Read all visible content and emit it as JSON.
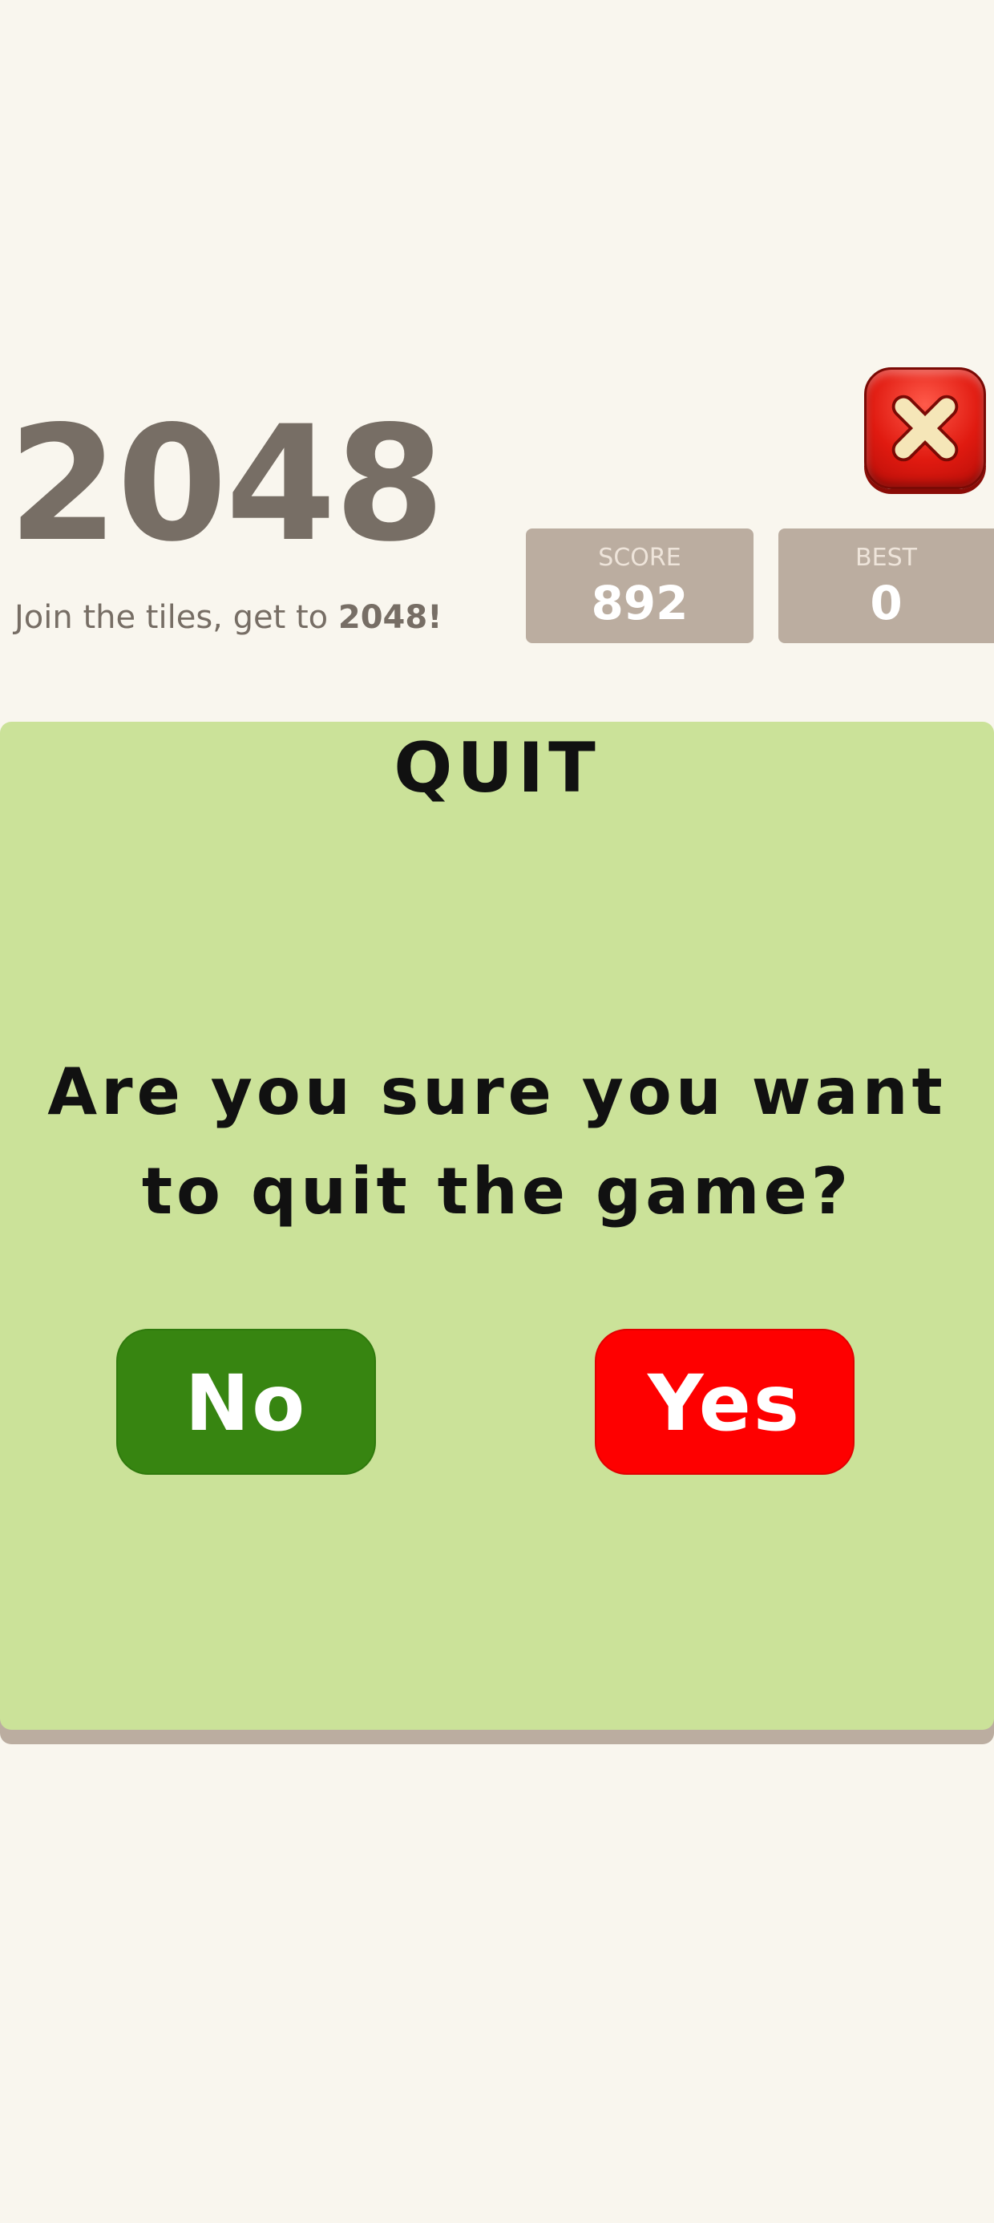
{
  "header": {
    "title": "2048",
    "subtitle_prefix": "Join the tiles, get to ",
    "subtitle_bold": "2048!"
  },
  "close_button": {
    "icon": "close-icon"
  },
  "scores": {
    "score_label": "SCORE",
    "score_value": "892",
    "best_label": "BEST",
    "best_value": "0"
  },
  "dialog": {
    "title": "QUIT",
    "message": "Are you sure you want to quit the game?",
    "no_label": "No",
    "yes_label": "Yes"
  },
  "colors": {
    "background": "#f9f6ee",
    "title_text": "#776e65",
    "score_box": "#bbada0",
    "dialog_bg": "#cbe299",
    "no_button": "#378511",
    "yes_button": "#fe0000"
  }
}
